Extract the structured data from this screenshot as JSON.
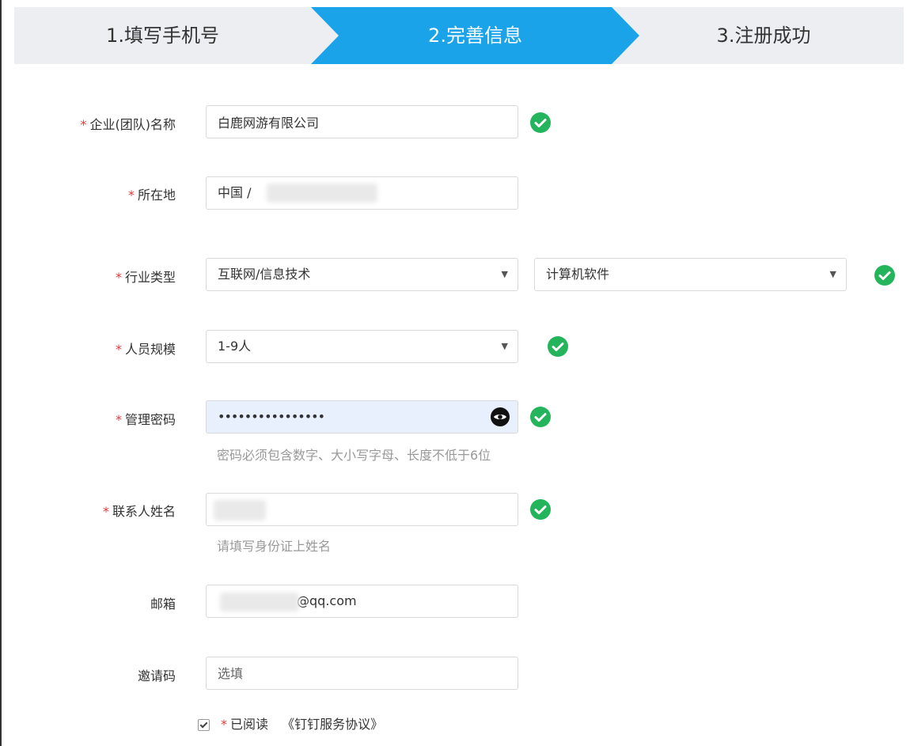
{
  "steps": [
    {
      "label": "1.填写手机号"
    },
    {
      "label": "2.完善信息"
    },
    {
      "label": "3.注册成功"
    }
  ],
  "colors": {
    "active_step": "#1aa3e8",
    "check": "#24b45b",
    "required": "#e4393c"
  },
  "form": {
    "company": {
      "label": "企业(团队)名称",
      "value": "白鹿网游有限公司"
    },
    "location": {
      "label": "所在地",
      "value": "中国 / "
    },
    "industry": {
      "label": "行业类型",
      "primary": "互联网/信息技术",
      "secondary": "计算机软件"
    },
    "size": {
      "label": "人员规模",
      "value": "1-9人"
    },
    "password": {
      "label": "管理密码",
      "value": "••••••••••••••••",
      "hint": "密码必须包含数字、大小写字母、长度不低于6位"
    },
    "contact": {
      "label": "联系人姓名",
      "hint": "请填写身份证上姓名"
    },
    "email": {
      "label": "邮箱",
      "value": "@qq.com"
    },
    "invite": {
      "label": "邀请码",
      "placeholder": "选填"
    },
    "agreement": {
      "read_label": "已阅读",
      "link": "《钉钉服务协议》"
    }
  },
  "icons": {
    "valid": "check-circle-icon",
    "reveal": "eye-icon",
    "dropdown": "caret-down-icon"
  },
  "arrow_glyph": "▼"
}
